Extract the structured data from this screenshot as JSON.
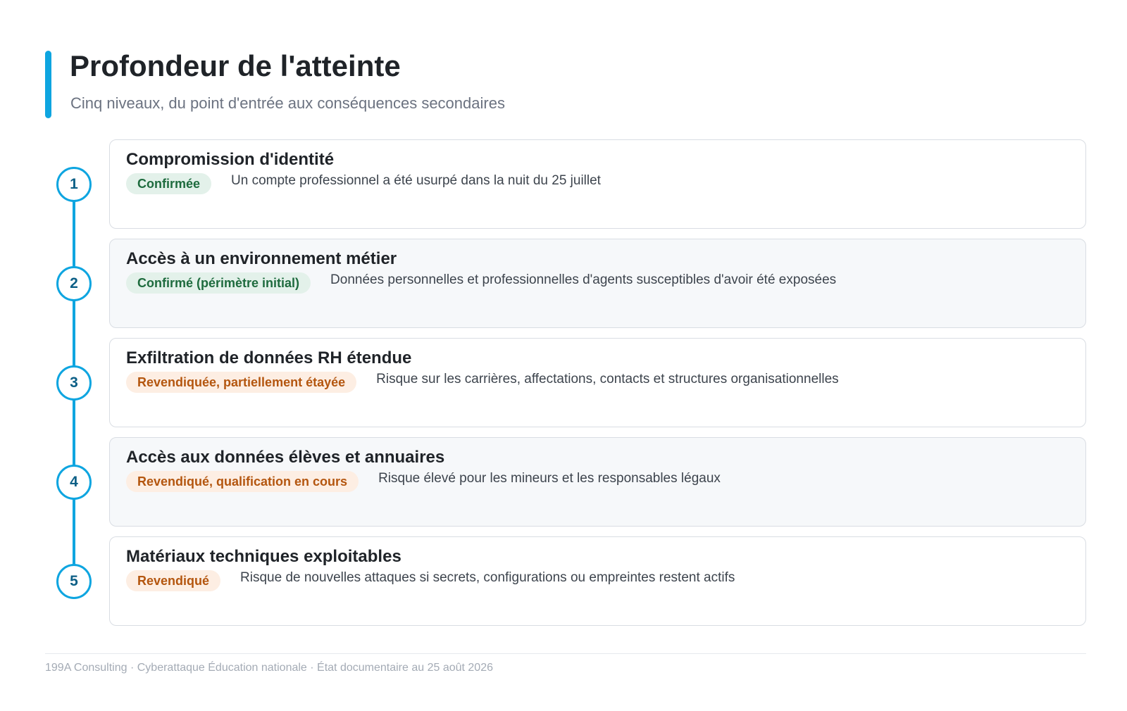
{
  "header": {
    "title": "Profondeur de l'atteinte",
    "subtitle": "Cinq niveaux, du point d'entrée aux conséquences secondaires"
  },
  "colors": {
    "accent": "#0ea5e0",
    "confirmed_badge_bg": "#e3f1ea",
    "confirmed_badge_text": "#1e6b3e",
    "claimed_badge_bg": "#fdeee3",
    "claimed_badge_text": "#b4560f"
  },
  "steps": [
    {
      "number": "1",
      "title": "Compromission d'identité",
      "status": "Confirmée",
      "status_tone": "green",
      "description": "Un compte professionnel a été usurpé dans la nuit du 25 juillet"
    },
    {
      "number": "2",
      "title": "Accès à un environnement métier",
      "status": "Confirmé (périmètre initial)",
      "status_tone": "green",
      "description": "Données personnelles et professionnelles d'agents susceptibles d'avoir été exposées"
    },
    {
      "number": "3",
      "title": "Exfiltration de données RH étendue",
      "status": "Revendiquée, partiellement étayée",
      "status_tone": "orange",
      "description": "Risque sur les carrières, affectations, contacts et structures organisationnelles"
    },
    {
      "number": "4",
      "title": "Accès aux données élèves et annuaires",
      "status": "Revendiqué, qualification en cours",
      "status_tone": "orange",
      "description": "Risque élevé pour les mineurs et les responsables légaux"
    },
    {
      "number": "5",
      "title": "Matériaux techniques exploitables",
      "status": "Revendiqué",
      "status_tone": "orange",
      "description": "Risque de nouvelles attaques si secrets, configurations ou empreintes restent actifs"
    }
  ],
  "footer": {
    "text": "199A Consulting · Cyberattaque Éducation nationale · État documentaire au 25 août 2026"
  }
}
